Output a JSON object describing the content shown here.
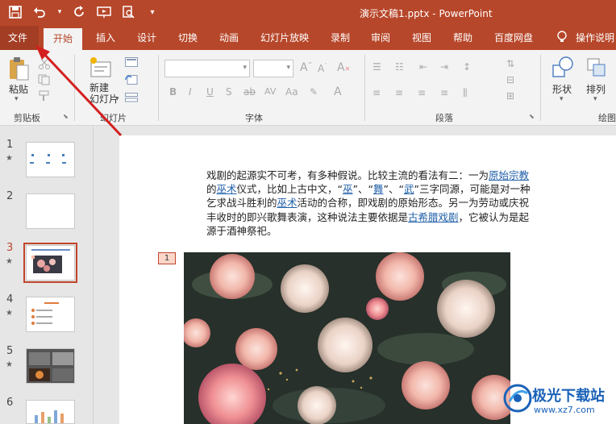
{
  "window": {
    "title": "演示文稿1.pptx  -  PowerPoint"
  },
  "tabs": [
    "文件",
    "开始",
    "插入",
    "设计",
    "切换",
    "动画",
    "幻灯片放映",
    "录制",
    "审阅",
    "视图",
    "帮助",
    "百度网盘",
    "操作说明"
  ],
  "ribbon": {
    "paste_label": "粘贴",
    "new_slide_label": "新建\n幻灯片",
    "shape_label": "形状",
    "arrange_label": "排列",
    "groups": [
      "剪贴板",
      "幻灯片",
      "字体",
      "段落",
      "绘图"
    ]
  },
  "slides": [
    {
      "num": "1"
    },
    {
      "num": "2"
    },
    {
      "num": "3"
    },
    {
      "num": "4"
    },
    {
      "num": "5"
    },
    {
      "num": "6"
    }
  ],
  "slide": {
    "para_parts": [
      "戏剧的起源实不可考，有多种假说。比较主流的看法有二：一为",
      "原始宗教",
      "的",
      "巫术",
      "仪式，比如上古中文，“",
      "巫",
      "”、“",
      "舞",
      "”、“",
      "武",
      "”三字同源，可能是对一种乞求战斗胜利的",
      "巫术",
      "活动的合称，即戏剧的原始形态。另一为劳动或庆祝丰收时的即兴歌舞表演，这种说法主要依据是",
      "古希腊戏剧",
      "，它被认为是起源于酒神祭祀。"
    ],
    "badge": "1"
  },
  "watermark": {
    "text": "极光下载站",
    "url": "www.xz7.com"
  },
  "colors": {
    "accent": "#b7472a",
    "link": "#1f5fa8"
  }
}
